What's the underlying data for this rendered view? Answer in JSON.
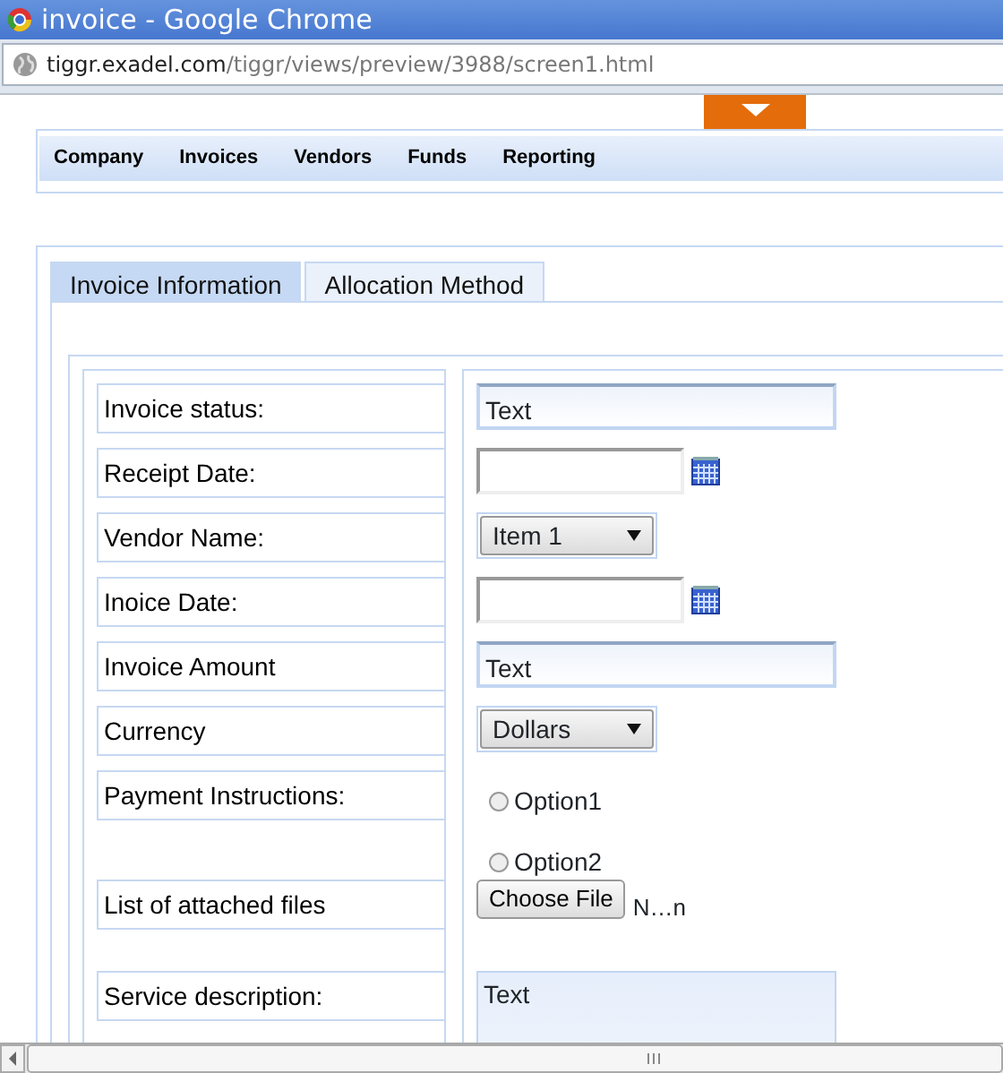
{
  "window": {
    "title": "invoice - Google Chrome"
  },
  "address": {
    "host": "tiggr.exadel.com",
    "path": "/tiggr/views/preview/3988/screen1.html"
  },
  "menu": [
    "Company",
    "Invoices",
    "Vendors",
    "Funds",
    "Reporting"
  ],
  "tabs": [
    {
      "label": "Invoice Information",
      "selected": true
    },
    {
      "label": "Allocation Method",
      "selected": false
    }
  ],
  "form": [
    {
      "label": "Invoice status:",
      "control": {
        "kind": "text",
        "value": "Text"
      }
    },
    {
      "label": "Receipt Date:",
      "control": {
        "kind": "date"
      }
    },
    {
      "label": "Vendor Name:",
      "control": {
        "kind": "select",
        "value": "Item 1"
      }
    },
    {
      "label": "Inoice Date:",
      "control": {
        "kind": "date"
      }
    },
    {
      "label": "Invoice Amount",
      "control": {
        "kind": "text",
        "value": "Text"
      }
    },
    {
      "label": "Currency",
      "control": {
        "kind": "select",
        "value": "Dollars"
      }
    },
    {
      "label": "Payment Instructions:",
      "control": {
        "kind": "radio",
        "options": [
          {
            "label": "Option1",
            "selected": false
          },
          {
            "label": "Option2",
            "selected": false
          }
        ]
      }
    },
    {
      "label": "List of attached files",
      "control": {
        "kind": "file",
        "button": "Choose File",
        "filename": "N…n"
      }
    },
    {
      "label": "Service description:",
      "control": {
        "kind": "textarea",
        "value": "Text"
      }
    }
  ]
}
